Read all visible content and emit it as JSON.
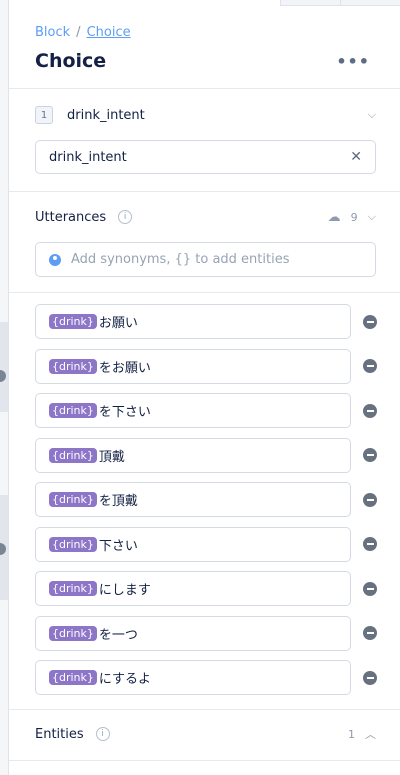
{
  "breadcrumb": {
    "parent": "Block",
    "separator": "/",
    "current": "Choice"
  },
  "page_title": "Choice",
  "more_label": "•••",
  "intent": {
    "number": "1",
    "name": "drink_intent",
    "input_value": "drink_intent",
    "clear_label": "✕",
    "chevron": "⌵"
  },
  "utterances": {
    "label": "Utterances",
    "info_label": "i",
    "count": "9",
    "search_placeholder": "Add synonyms, {} to add entities",
    "items": [
      {
        "entity": "{drink}",
        "text": "お願い"
      },
      {
        "entity": "{drink}",
        "text": "をお願い"
      },
      {
        "entity": "{drink}",
        "text": "を下さい"
      },
      {
        "entity": "{drink}",
        "text": "頂戴"
      },
      {
        "entity": "{drink}",
        "text": "を頂戴"
      },
      {
        "entity": "{drink}",
        "text": "下さい"
      },
      {
        "entity": "{drink}",
        "text": "にします"
      },
      {
        "entity": "{drink}",
        "text": "を一つ"
      },
      {
        "entity": "{drink}",
        "text": "にするよ"
      }
    ]
  },
  "entities": {
    "label": "Entities",
    "info_label": "i",
    "count": "1",
    "chevron": "︿"
  },
  "colors": {
    "accent": "#5d9df5",
    "entity_tag": "#8d76c8",
    "text": "#132144"
  }
}
